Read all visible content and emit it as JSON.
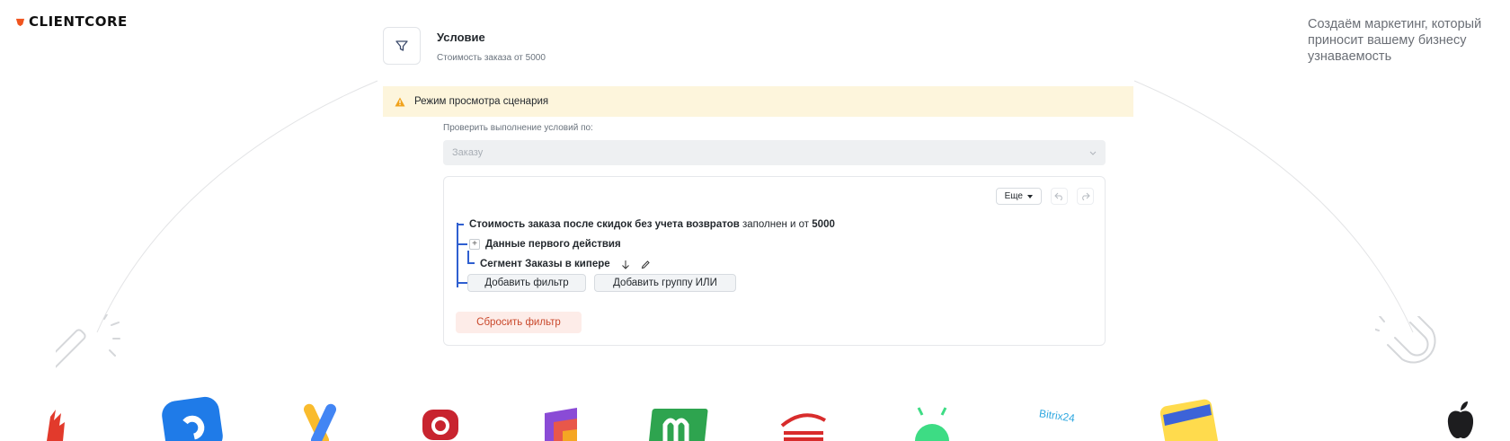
{
  "brand": {
    "name": "CLIENTCORE",
    "accent": "#f0541e"
  },
  "tagline": "Создаём маркетинг, который приносит вашему бизнесу узнаваемость",
  "condition": {
    "icon": "filter-icon",
    "title": "Условие",
    "subtitle": "Стоимость заказа от 5000"
  },
  "alert": {
    "icon": "warning-icon",
    "text": "Режим просмотра сценария",
    "color": "#fdf5dc"
  },
  "check": {
    "label": "Проверить выполнение условий по:",
    "select_value": "Заказу"
  },
  "filter": {
    "more_label": "Еще",
    "undo_icon": "undo-icon",
    "redo_icon": "redo-icon",
    "rule_bold": "Стоимость заказа после скидок без учета возвратов",
    "rule_mid": "заполнен и от",
    "rule_value": "5000",
    "group_label": "Данные первого действия",
    "segment_label": "Сегмент Заказы в кипере",
    "add_filter": "Добавить фильтр",
    "add_or_group": "Добавить группу ИЛИ",
    "reset": "Сбросить фильтр",
    "line_color": "#2f5fd0"
  },
  "partner_logos": [
    "logo-red",
    "logo-blue",
    "logo-google-ads",
    "logo-red-ring",
    "logo-purple",
    "logo-green-m",
    "logo-red-stripes",
    "logo-android",
    "logo-bitrix24",
    "logo-yandex",
    "logo-apple"
  ],
  "partner_logo_text": {
    "bitrix": "Bitrix24"
  }
}
